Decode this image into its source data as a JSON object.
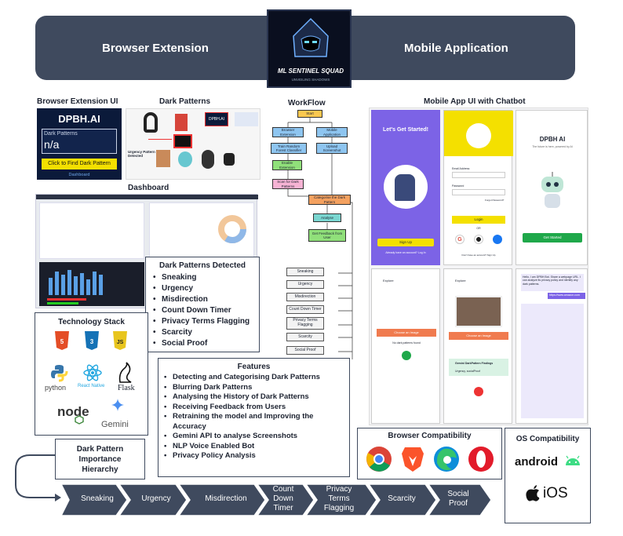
{
  "banner": {
    "left": "Browser Extension",
    "right": "Mobile Application",
    "logo_title": "ML SENTINEL SQUAD",
    "logo_sub": "UNVEILING SHADOWS"
  },
  "sections": {
    "ext_ui": "Browser Extension UI",
    "dark_patterns": "Dark Patterns",
    "dashboard": "Dashboard",
    "workflow": "WorkFlow",
    "mobile_ui": "Mobile App UI with Chatbot",
    "tech_stack": "Technology Stack",
    "features": "Features",
    "dpd": "Dark Patterns Detected",
    "importance": "Dark Pattern Importance Hierarchy",
    "browser_compat": "Browser Compatibility",
    "os_compat": "OS Compatibility"
  },
  "extension": {
    "title": "DPBH.AI",
    "field_label": "Dark Patterns",
    "field_value": "n/a",
    "button": "Click to Find Dark Pattern",
    "link": "Dashboard"
  },
  "dp_callouts": {
    "urgency": "Urgency Pattern Detected",
    "logo": "DPBH.AI"
  },
  "detected": [
    "Sneaking",
    "Urgency",
    "Misdirection",
    "Count Down Timer",
    "Privacy Terms Flagging",
    "Scarcity",
    "Social Proof"
  ],
  "features": [
    "Detecting and Categorising Dark Patterns",
    "Blurring Dark Patterns",
    "Analysing the History of Dark Patterns",
    "Receiving Feedback from Users",
    "Retraining the model and Improving the Accuracy",
    "Gemini API to analyse Screenshots",
    "NLP Voice Enabled Bot",
    "Privacy Policy Analysis"
  ],
  "tech": {
    "python": "python",
    "react": "React Native",
    "flask": "Flask",
    "node": "node",
    "gemini": "Gemini",
    "html": "HTML",
    "css": "CSS",
    "js": "JS"
  },
  "workflow": {
    "start": "Start",
    "browser_ext": "Browser Extension",
    "mobile_app": "Mobile Application",
    "train": "Train Random Forest Classifier",
    "upload": "Upload Screenshot",
    "enable": "Enable Extension",
    "scan": "Scan for Dark Patterns",
    "categorise": "Categorise the Dark Pattern",
    "analyse": "Analyse",
    "feedback": "Get Feedback from User",
    "outputs": [
      "Sneaking",
      "Urgency",
      "Misdirection",
      "Count Down Timer",
      "Privacy Terms Flagging",
      "Scarcity",
      "Social Proof"
    ]
  },
  "hierarchy": [
    "Sneaking",
    "Urgency",
    "Misdirection",
    "Count Down Timer",
    "Privacy Terms Flagging",
    "Scarcity",
    "Social Proof"
  ],
  "browsers": [
    "chrome-icon",
    "brave-icon",
    "edge-icon",
    "opera-icon"
  ],
  "os": {
    "android": "android",
    "ios": "iOS"
  },
  "mobile": {
    "s1_title": "Let's Get Started!",
    "s1_btn": "Sign Up",
    "s1_link": "Already have an account? Log In",
    "s2_email": "Email Address",
    "s2_pass": "Password",
    "s2_forgot": "Forgot Password?",
    "s2_login": "Login",
    "s2_or": "OR",
    "s2_signup": "Don't have an account? Sign Up",
    "s3_title": "DPBH AI",
    "s3_sub": "The future is here, powered by AI",
    "s3_btn": "Get Started",
    "explore": "Explore",
    "choose": "Choose an Image",
    "no_img": "No dark patterns found",
    "findings": "Gemini DarkPattern Findings",
    "findings_sub": "Urgency, socialProof",
    "chat_hello": "Hello, I am DPBH Bot. Share a webpage URL. I can analyze its privacy policy and identify any dark patterns.",
    "chat_url": "https://www.amazon.com"
  },
  "colors": {
    "banner": "#3f4a5e",
    "chevron": "#3f4a5e",
    "purple": "#7c63e6",
    "green": "#1fa84a",
    "yellow": "#f4e000"
  }
}
